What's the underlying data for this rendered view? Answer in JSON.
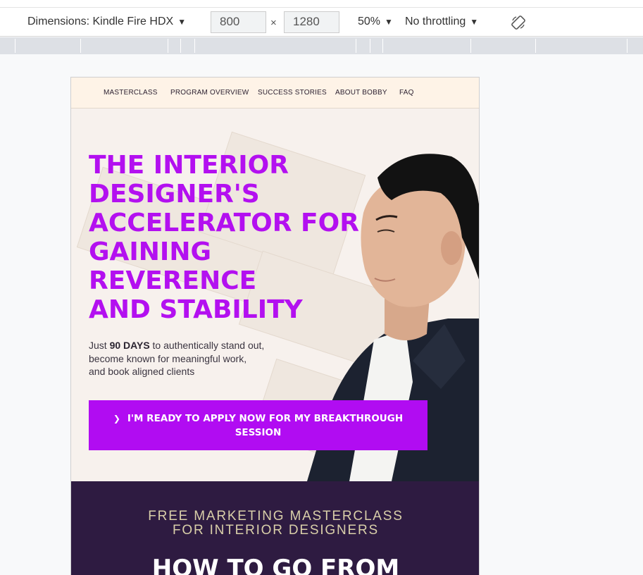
{
  "devtools": {
    "dimensions_label": "Dimensions: Kindle Fire HDX",
    "width_value": "800",
    "height_value": "1280",
    "times_sign": "×",
    "zoom": "50%",
    "throttle": "No throttling",
    "caret": "▼",
    "rotate_icon": "rotate-icon"
  },
  "site": {
    "nav": [
      "MASTERCLASS",
      "PROGRAM OVERVIEW",
      "SUCCESS STORIES",
      "ABOUT BOBBY",
      "FAQ"
    ],
    "hero": {
      "title_lines": [
        "THE INTERIOR",
        "DESIGNER'S",
        "ACCELERATOR FOR",
        "GAINING",
        "REVERENCE",
        "AND STABILITY"
      ],
      "sub_prefix": "Just ",
      "sub_bold": "90 DAYS",
      "sub_rest_1": " to authentically stand out,",
      "sub_line_2": "become known for meaningful work,",
      "sub_line_3": "and book aligned clients",
      "cta_label": "I'M READY TO APPLY NOW FOR MY BREAKTHROUGH SESSION"
    },
    "band": {
      "kicker_line_1": "FREE MARKETING MASTERCLASS",
      "kicker_line_2": "FOR INTERIOR DESIGNERS",
      "heading": "HOW TO GO FROM"
    }
  },
  "colors": {
    "accent": "#b10cf2",
    "title": "#b310f0",
    "band": "#2e1b41",
    "nav_bg": "#fef3e7",
    "kicker": "#d9cfa9"
  }
}
